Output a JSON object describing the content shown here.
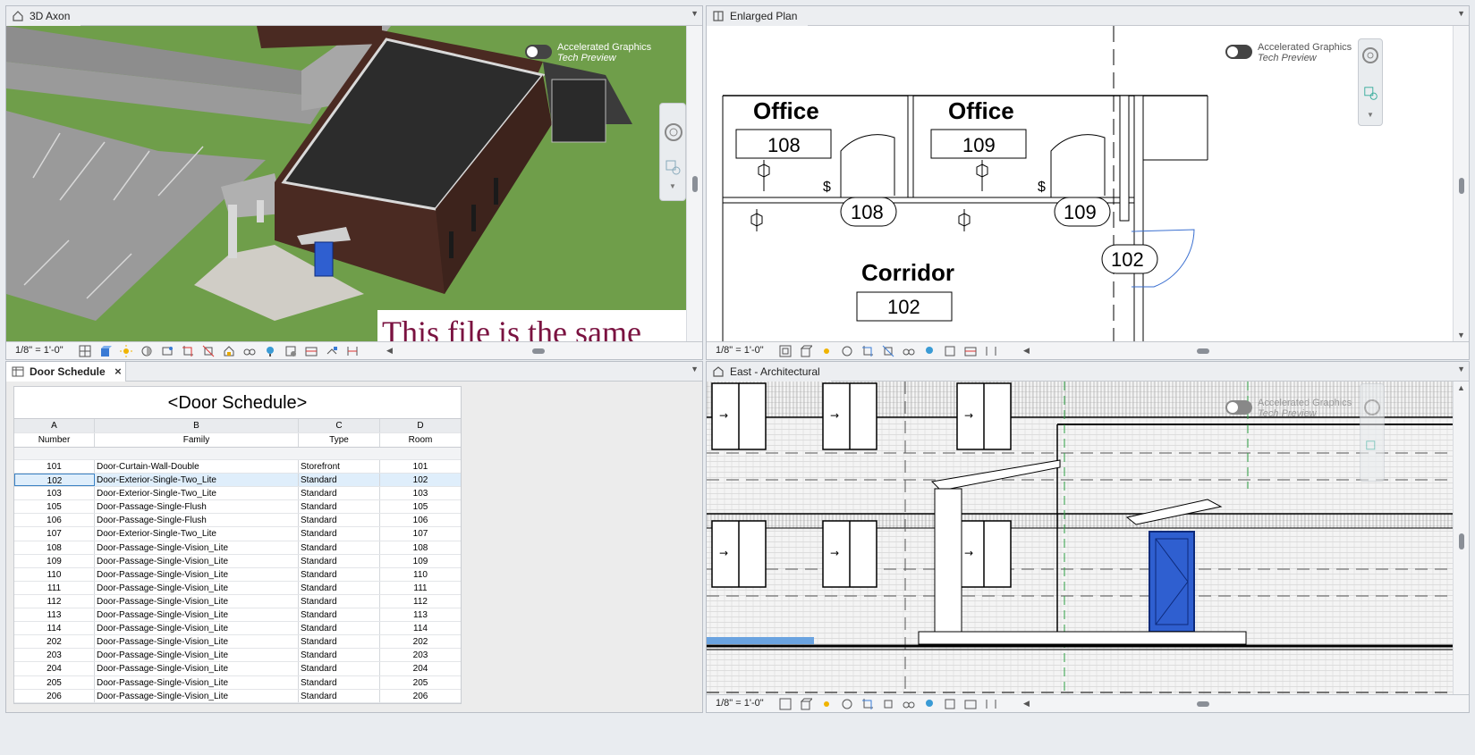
{
  "panes": {
    "axon": {
      "tab": "3D Axon",
      "scale": "1/8\" = 1'-0\"",
      "overlay_text": "This file is the same"
    },
    "plan": {
      "tab": "Enlarged Plan",
      "scale": "1/8\" = 1'-0\"",
      "rooms": [
        {
          "name": "Office",
          "number": "108",
          "door": "108"
        },
        {
          "name": "Office",
          "number": "109",
          "door": "109"
        },
        {
          "name": "Corridor",
          "number": "102",
          "door": "102"
        }
      ]
    },
    "schedule": {
      "tab": "Door Schedule",
      "close": "×"
    },
    "elevation": {
      "tab": "East - Architectural",
      "scale": "1/8\" = 1'-0\""
    }
  },
  "accelerated_graphics": {
    "title": "Accelerated Graphics",
    "subtitle": "Tech Preview"
  },
  "schedule": {
    "title": "<Door Schedule>",
    "col_letters": [
      "A",
      "B",
      "C",
      "D"
    ],
    "col_names": [
      "Number",
      "Family",
      "Type",
      "Room"
    ],
    "rows": [
      [
        "101",
        "Door-Curtain-Wall-Double",
        "Storefront",
        "101"
      ],
      [
        "102",
        "Door-Exterior-Single-Two_Lite",
        "Standard",
        "102"
      ],
      [
        "103",
        "Door-Exterior-Single-Two_Lite",
        "Standard",
        "103"
      ],
      [
        "105",
        "Door-Passage-Single-Flush",
        "Standard",
        "105"
      ],
      [
        "106",
        "Door-Passage-Single-Flush",
        "Standard",
        "106"
      ],
      [
        "107",
        "Door-Exterior-Single-Two_Lite",
        "Standard",
        "107"
      ],
      [
        "108",
        "Door-Passage-Single-Vision_Lite",
        "Standard",
        "108"
      ],
      [
        "109",
        "Door-Passage-Single-Vision_Lite",
        "Standard",
        "109"
      ],
      [
        "110",
        "Door-Passage-Single-Vision_Lite",
        "Standard",
        "110"
      ],
      [
        "111",
        "Door-Passage-Single-Vision_Lite",
        "Standard",
        "111"
      ],
      [
        "112",
        "Door-Passage-Single-Vision_Lite",
        "Standard",
        "112"
      ],
      [
        "113",
        "Door-Passage-Single-Vision_Lite",
        "Standard",
        "113"
      ],
      [
        "114",
        "Door-Passage-Single-Vision_Lite",
        "Standard",
        "114"
      ],
      [
        "202",
        "Door-Passage-Single-Vision_Lite",
        "Standard",
        "202"
      ],
      [
        "203",
        "Door-Passage-Single-Vision_Lite",
        "Standard",
        "203"
      ],
      [
        "204",
        "Door-Passage-Single-Vision_Lite",
        "Standard",
        "204"
      ],
      [
        "205",
        "Door-Passage-Single-Vision_Lite",
        "Standard",
        "205"
      ],
      [
        "206",
        "Door-Passage-Single-Vision_Lite",
        "Standard",
        "206"
      ]
    ],
    "selected_row": 1
  },
  "colors": {
    "grass": "#6f9e4a",
    "roof": "#2c2c2c",
    "brick": "#4a2a22",
    "door_blue": "#2f5fd0",
    "overlay_text": "#7a1240",
    "grid_green": "#2ea043"
  }
}
